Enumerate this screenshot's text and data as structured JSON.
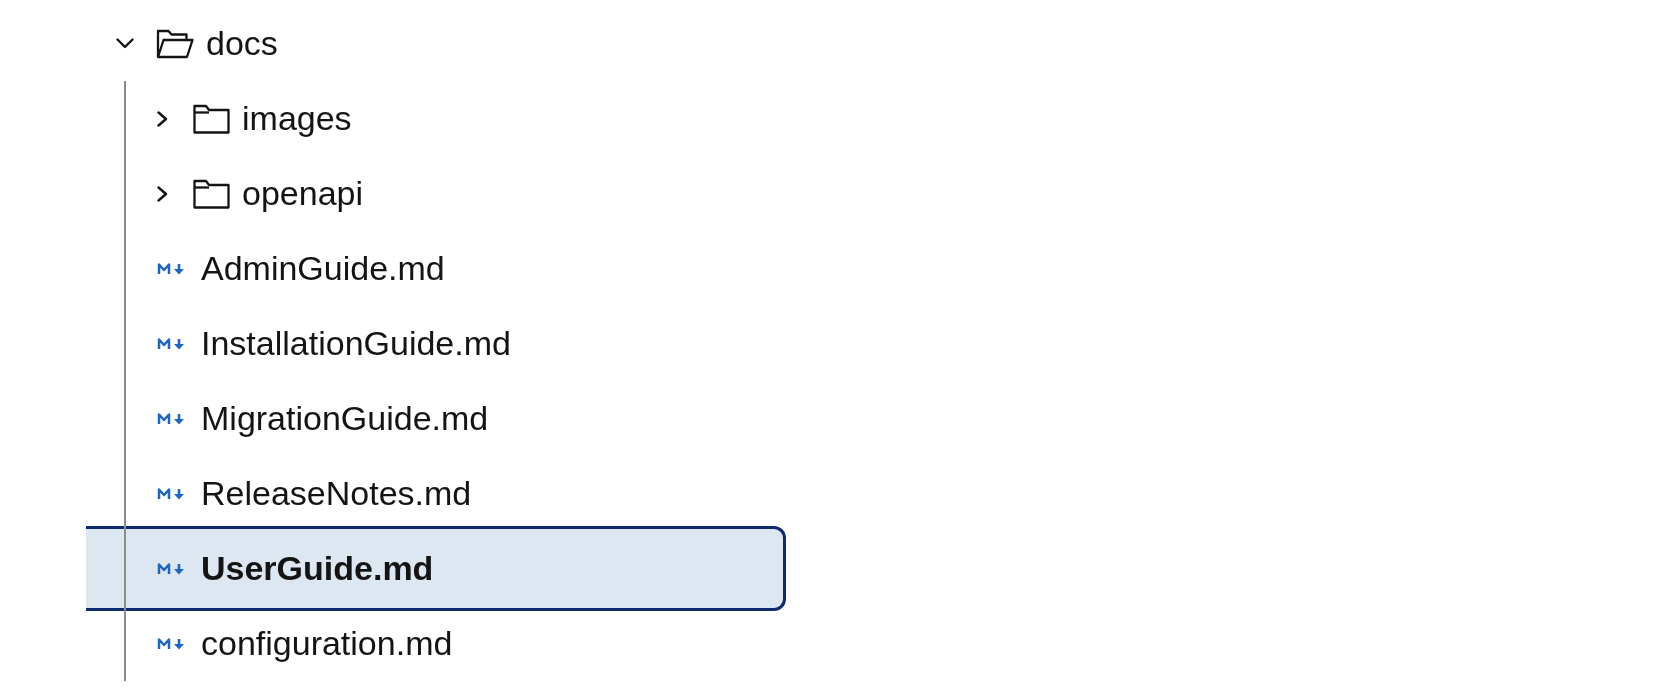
{
  "tree": [
    {
      "kind": "folder",
      "label": "docs",
      "expanded": true,
      "selected": false,
      "children": [
        {
          "kind": "folder",
          "label": "images",
          "expanded": false,
          "selected": false
        },
        {
          "kind": "folder",
          "label": "openapi",
          "expanded": false,
          "selected": false
        },
        {
          "kind": "file",
          "label": "AdminGuide.md",
          "selected": false
        },
        {
          "kind": "file",
          "label": "InstallationGuide.md",
          "selected": false
        },
        {
          "kind": "file",
          "label": "MigrationGuide.md",
          "selected": false
        },
        {
          "kind": "file",
          "label": "ReleaseNotes.md",
          "selected": false
        },
        {
          "kind": "file",
          "label": "UserGuide.md",
          "selected": true
        },
        {
          "kind": "file",
          "label": "configuration.md",
          "selected": false
        }
      ]
    }
  ]
}
